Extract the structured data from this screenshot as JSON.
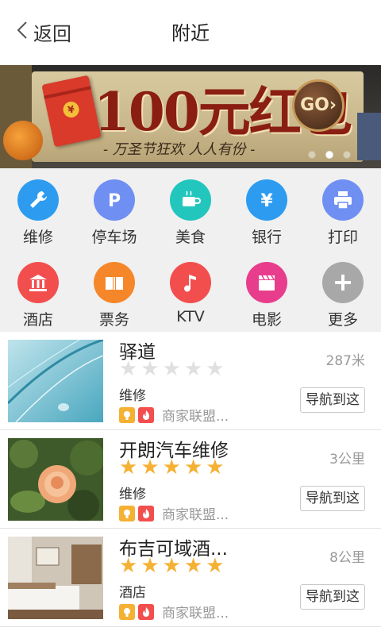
{
  "header": {
    "back_label": "返回",
    "title": "附近"
  },
  "banner": {
    "headline": "100元红包",
    "subline": "- 万圣节狂欢 人人有份 -",
    "button": "GO",
    "coin": "¥",
    "slides": 3,
    "active_slide": 1
  },
  "categories": [
    {
      "label": "维修",
      "icon": "wrench-icon",
      "color": "#2d9cf0"
    },
    {
      "label": "停车场",
      "icon": "parking-icon",
      "color": "#6f8ff2"
    },
    {
      "label": "美食",
      "icon": "coffee-cup-icon",
      "color": "#22c6bd"
    },
    {
      "label": "银行",
      "icon": "yen-icon",
      "color": "#2d9cf0"
    },
    {
      "label": "打印",
      "icon": "printer-icon",
      "color": "#6f8ff2"
    },
    {
      "label": "酒店",
      "icon": "building-icon",
      "color": "#f24e4e"
    },
    {
      "label": "票务",
      "icon": "ticket-book-icon",
      "color": "#f5872a"
    },
    {
      "label": "KTV",
      "icon": "music-note-icon",
      "color": "#f24e4e"
    },
    {
      "label": "电影",
      "icon": "clapperboard-icon",
      "color": "#e83d8c"
    },
    {
      "label": "更多",
      "icon": "plus-icon",
      "color": "#a8a8a8"
    }
  ],
  "items": [
    {
      "name": "驿道",
      "rating": 0,
      "category": "维修",
      "distance": "287米",
      "tag_text": "商家联盟...",
      "nav_label": "导航到这",
      "thumb": "feather-thumbnail"
    },
    {
      "name": "开朗汽车维修",
      "rating": 5,
      "category": "维修",
      "distance": "3公里",
      "tag_text": "商家联盟...",
      "nav_label": "导航到这",
      "thumb": "rose-thumbnail"
    },
    {
      "name": "布吉可域酒...",
      "rating": 5,
      "category": "酒店",
      "distance": "8公里",
      "tag_text": "商家联盟...",
      "nav_label": "导航到这",
      "thumb": "hotel-room-thumbnail"
    }
  ],
  "colors": {
    "star_on": "#f5b134",
    "star_off": "#e0e0e0",
    "tag_bulb": "#f5b134",
    "tag_fire": "#f24e4e"
  }
}
